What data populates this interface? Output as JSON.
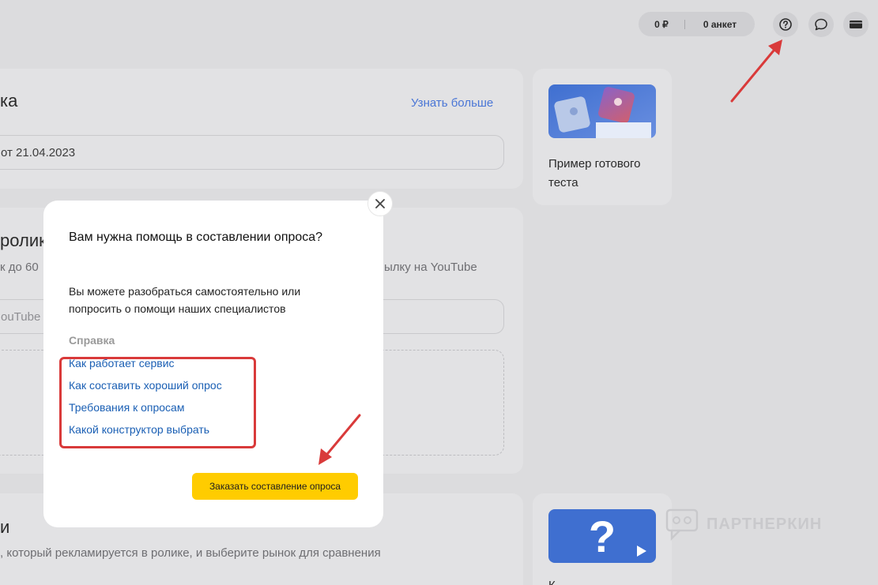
{
  "topbar": {
    "balance": "0 ₽",
    "forms_count": "0 анкет",
    "help_icon": "question-circle-icon",
    "chat_icon": "chat-bubble-icon",
    "account_icon": "card-icon"
  },
  "background": {
    "card1_title": "ка",
    "card1_link": "Узнать больше",
    "card1_input": "от 21.04.2023",
    "card2_title": "ролик",
    "card2_desc_left": "к до 60",
    "card2_desc_right": "ылку на YouTube",
    "card2_input_placeholder": "ouTube",
    "card3_title": "и",
    "card3_desc": ", который рекламируется в ролике, и выберите рынок для сравнения",
    "side1_text": "Пример готового теста",
    "side2_text": "К"
  },
  "modal": {
    "title": "Вам нужна помощь в составлении опроса?",
    "description": "Вы можете разобраться самостоятельно или попросить о помощи наших специалистов",
    "section_label": "Справка",
    "links": [
      "Как работает сервис",
      "Как составить хороший опрос",
      "Требования к опросам",
      "Какой конструктор выбрать"
    ],
    "order_button": "Заказать составление опроса"
  },
  "watermark": "ПАРТНЕРКИН",
  "colors": {
    "accent_yellow": "#ffcc00",
    "link_blue": "#1a5fb4",
    "annotation_red": "#d93a3a"
  }
}
